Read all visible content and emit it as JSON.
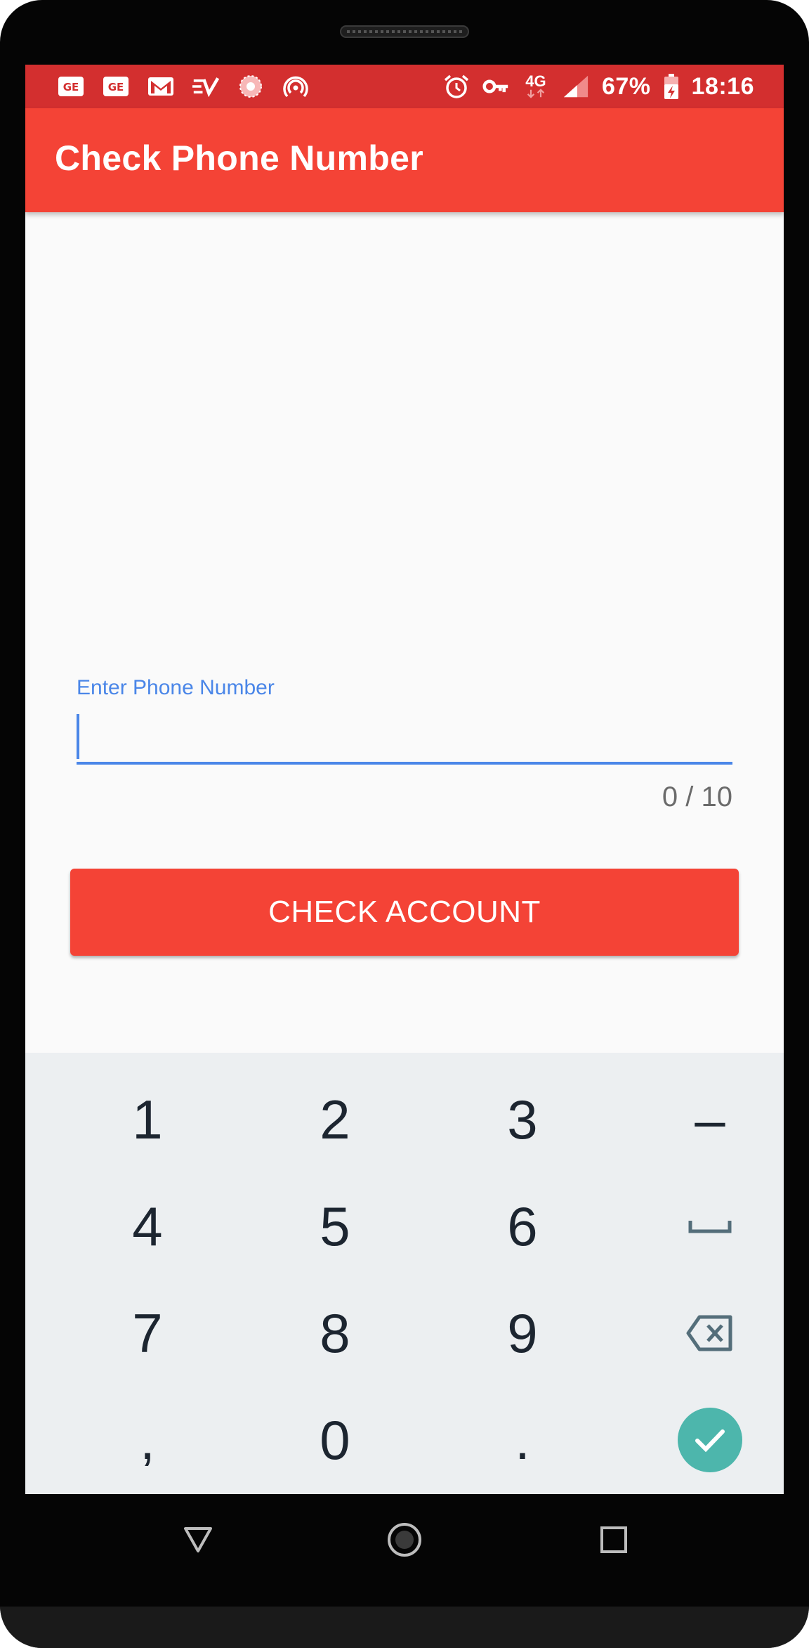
{
  "statusbar": {
    "icons_left": [
      "ge-app-icon",
      "ge-app-icon",
      "gmail-icon",
      "expressvpn-icon",
      "pinwheel-app-icon",
      "hotspot-icon"
    ],
    "icons_right": [
      "alarm-icon",
      "vpn-key-icon",
      "network-4g-icon",
      "signal-icon",
      "battery-charging-icon"
    ],
    "network_label": "4G",
    "battery": "67%",
    "time": "18:16"
  },
  "appbar": {
    "title": "Check Phone Number"
  },
  "form": {
    "label": "Enter Phone Number",
    "value": "",
    "counter": "0 / 10",
    "button_label": "CHECK ACCOUNT"
  },
  "keypad": {
    "keys": [
      "1",
      "2",
      "3",
      "–",
      "4",
      "5",
      "6",
      "",
      "7",
      "8",
      "9",
      "",
      ",",
      "0",
      ".",
      ""
    ],
    "key_names": [
      "key-1",
      "key-2",
      "key-3",
      "key-minus",
      "key-4",
      "key-5",
      "key-6",
      "key-space",
      "key-7",
      "key-8",
      "key-9",
      "key-backspace",
      "key-comma",
      "key-0",
      "key-period",
      "key-done"
    ]
  },
  "colors": {
    "status_bar": "#d32f2f",
    "app_bar": "#f44336",
    "accent": "#4a86e8",
    "done_key": "#4db6ac",
    "keypad_bg": "#eceff1"
  },
  "navbar": {
    "buttons": [
      "back-icon",
      "home-icon",
      "recents-icon"
    ]
  }
}
